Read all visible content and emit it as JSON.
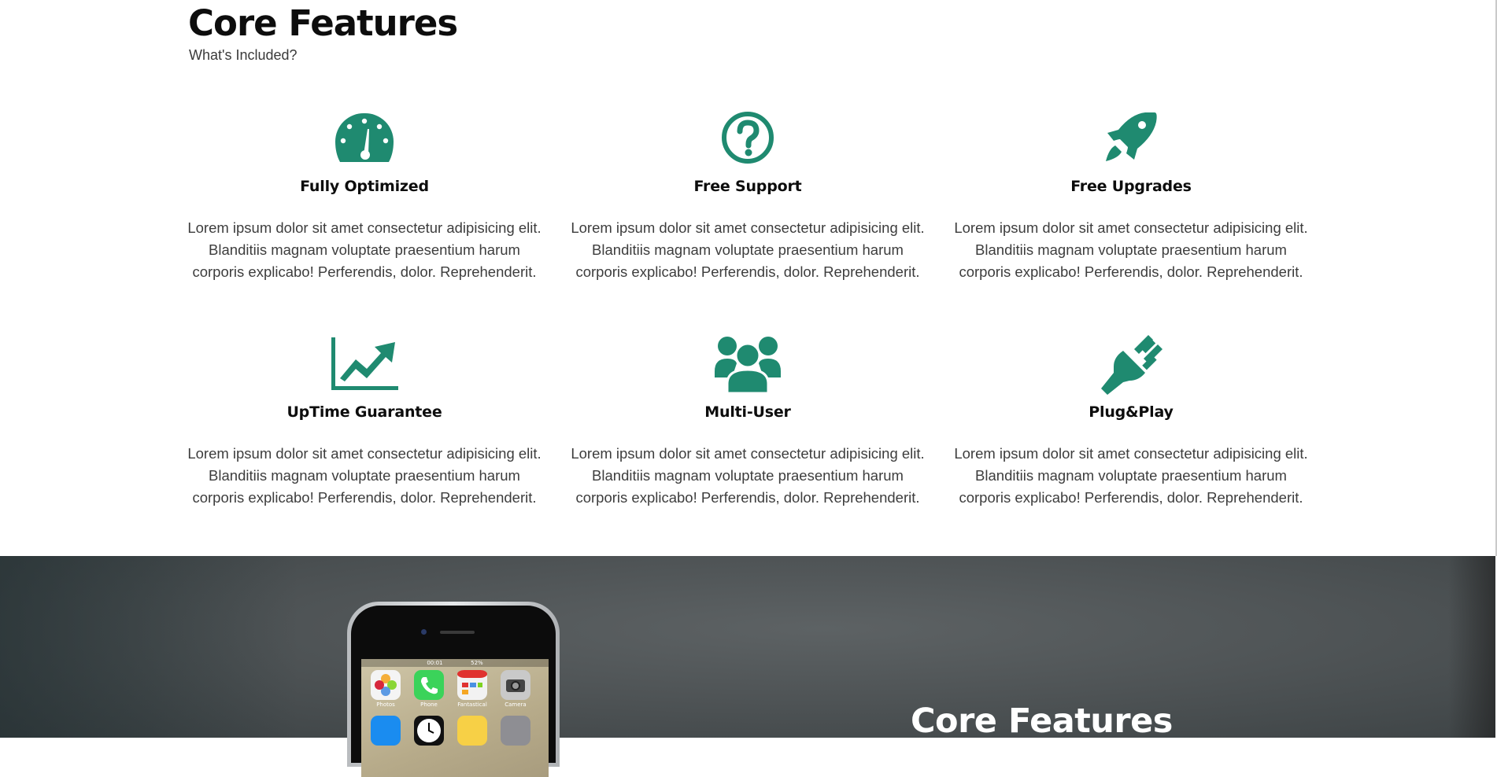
{
  "core_section": {
    "title": "Core Features",
    "subtitle": "What's Included?",
    "accent_color": "#1f8a70",
    "features": [
      {
        "icon": "speedometer-icon",
        "title": "Fully Optimized",
        "text": "Lorem ipsum dolor sit amet consectetur adipisicing elit. Blanditiis magnam voluptate praesentium harum corporis explicabo! Perferendis, dolor. Reprehenderit."
      },
      {
        "icon": "question-circle-icon",
        "title": "Free Support",
        "text": "Lorem ipsum dolor sit amet consectetur adipisicing elit. Blanditiis magnam voluptate praesentium harum corporis explicabo! Perferendis, dolor. Reprehenderit."
      },
      {
        "icon": "rocket-icon",
        "title": "Free Upgrades",
        "text": "Lorem ipsum dolor sit amet consectetur adipisicing elit. Blanditiis magnam voluptate praesentium harum corporis explicabo! Perferendis, dolor. Reprehenderit."
      },
      {
        "icon": "chart-line-icon",
        "title": "UpTime Guarantee",
        "text": "Lorem ipsum dolor sit amet consectetur adipisicing elit. Blanditiis magnam voluptate praesentium harum corporis explicabo! Perferendis, dolor. Reprehenderit."
      },
      {
        "icon": "users-icon",
        "title": "Multi-User",
        "text": "Lorem ipsum dolor sit amet consectetur adipisicing elit. Blanditiis magnam voluptate praesentium harum corporis explicabo! Perferendis, dolor. Reprehenderit."
      },
      {
        "icon": "plug-icon",
        "title": "Plug&Play",
        "text": "Lorem ipsum dolor sit amet consectetur adipisicing elit. Blanditiis magnam voluptate praesentium harum corporis explicabo! Perferendis, dolor. Reprehenderit."
      }
    ]
  },
  "dark_section": {
    "title": "Core Features",
    "phone": {
      "status_time": "00:01",
      "status_battery": "52%",
      "apps": [
        {
          "label": "Photos",
          "color": "#f4f4f4"
        },
        {
          "label": "Phone",
          "color": "#3bd35a"
        },
        {
          "label": "Fantastical",
          "color": "#f2f2f2"
        },
        {
          "label": "Camera",
          "color": "#c9c9c9"
        }
      ]
    }
  }
}
